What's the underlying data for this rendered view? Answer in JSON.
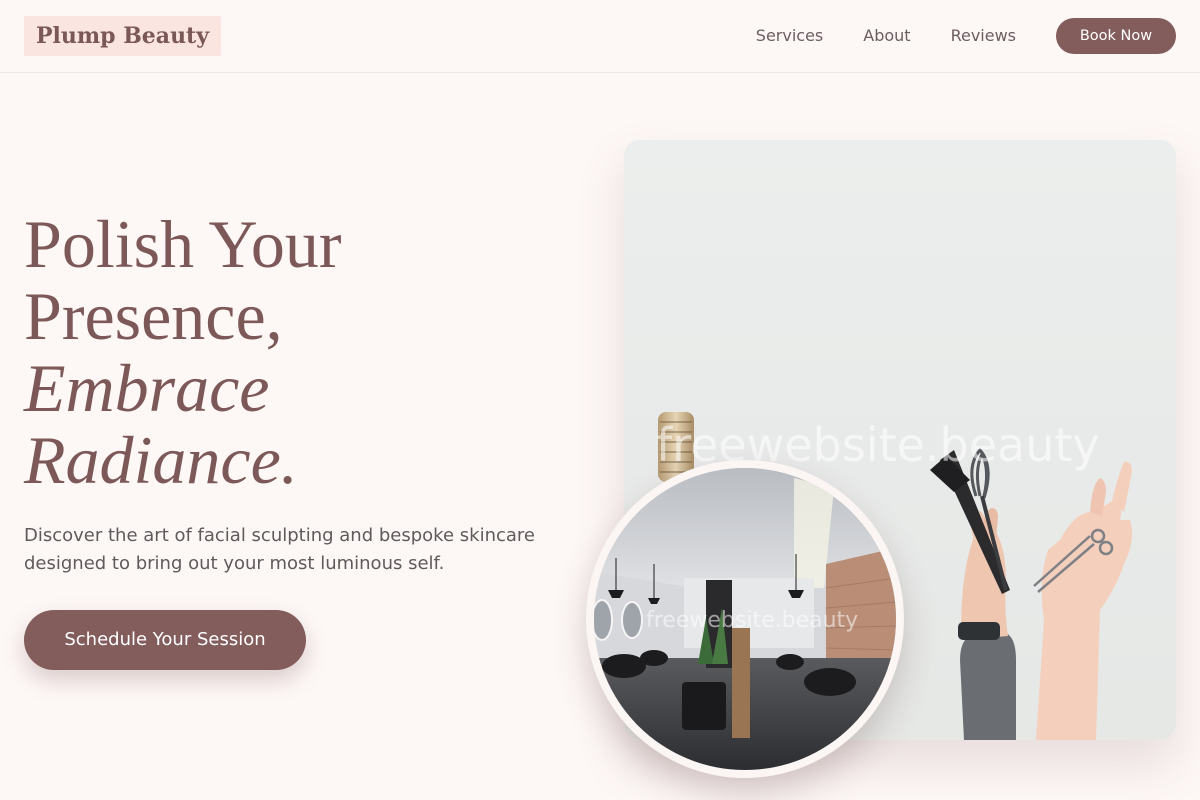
{
  "brand": {
    "name": "Plump Beauty"
  },
  "nav": {
    "links": [
      "Services",
      "About",
      "Reviews"
    ],
    "book_label": "Book Now"
  },
  "hero": {
    "title_line1": "Polish Your",
    "title_line2": "Presence,",
    "title_line3": "Embrace",
    "title_line4": "Radiance.",
    "description": "Discover the art of facial sculpting and bespoke skincare designed to bring out your most luminous self.",
    "cta_label": "Schedule Your Session"
  },
  "images": {
    "main_watermark": "freewebsite.beauty",
    "circle_watermark": "freewebsite.beauty"
  },
  "colors": {
    "background": "#fdf7f6",
    "accent": "#835c5c",
    "logo_bg": "#fbe5e1",
    "text": "#7c5858"
  }
}
